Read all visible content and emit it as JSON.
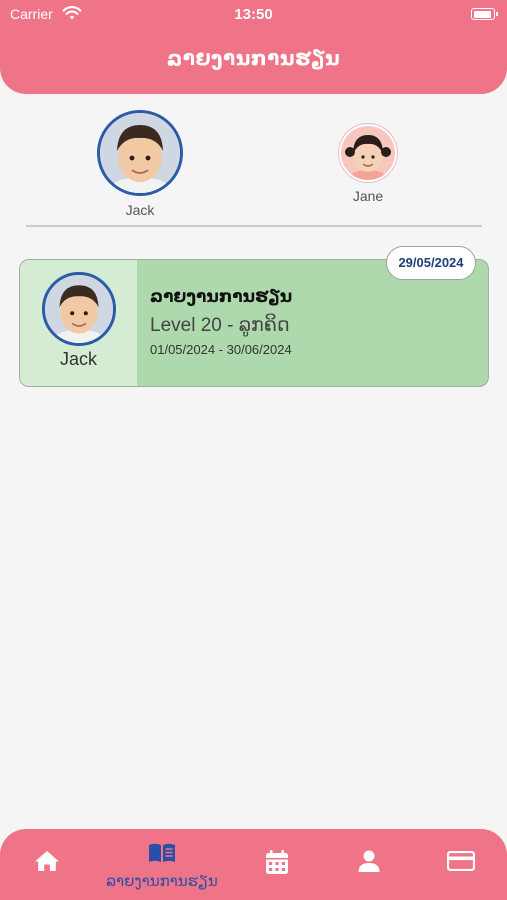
{
  "status_bar": {
    "carrier": "Carrier",
    "time": "13:50"
  },
  "header": {
    "title": "ລາຍງານການຮຽນ"
  },
  "children": [
    {
      "name": "Jack",
      "selected": true
    },
    {
      "name": "Jane",
      "selected": false
    }
  ],
  "report_card": {
    "child_name": "Jack",
    "title": "ລາຍງານການຮຽນ",
    "level": "Level 20 - ລູກຄິດ",
    "date_range": "01/05/2024 - 30/06/2024",
    "report_date": "29/05/2024"
  },
  "tabbar": {
    "items": [
      {
        "icon": "home-icon",
        "label": ""
      },
      {
        "icon": "book-icon",
        "label": "ລາຍງານການຮຽນ",
        "active": true
      },
      {
        "icon": "calendar-icon",
        "label": ""
      },
      {
        "icon": "person-icon",
        "label": ""
      },
      {
        "icon": "card-icon",
        "label": ""
      }
    ]
  },
  "colors": {
    "header_pink": "#f07487",
    "card_green": "#add9ad",
    "card_green_light": "#d4ecd3",
    "accent_blue": "#2b4fa8",
    "background": "#f5f5f5"
  }
}
